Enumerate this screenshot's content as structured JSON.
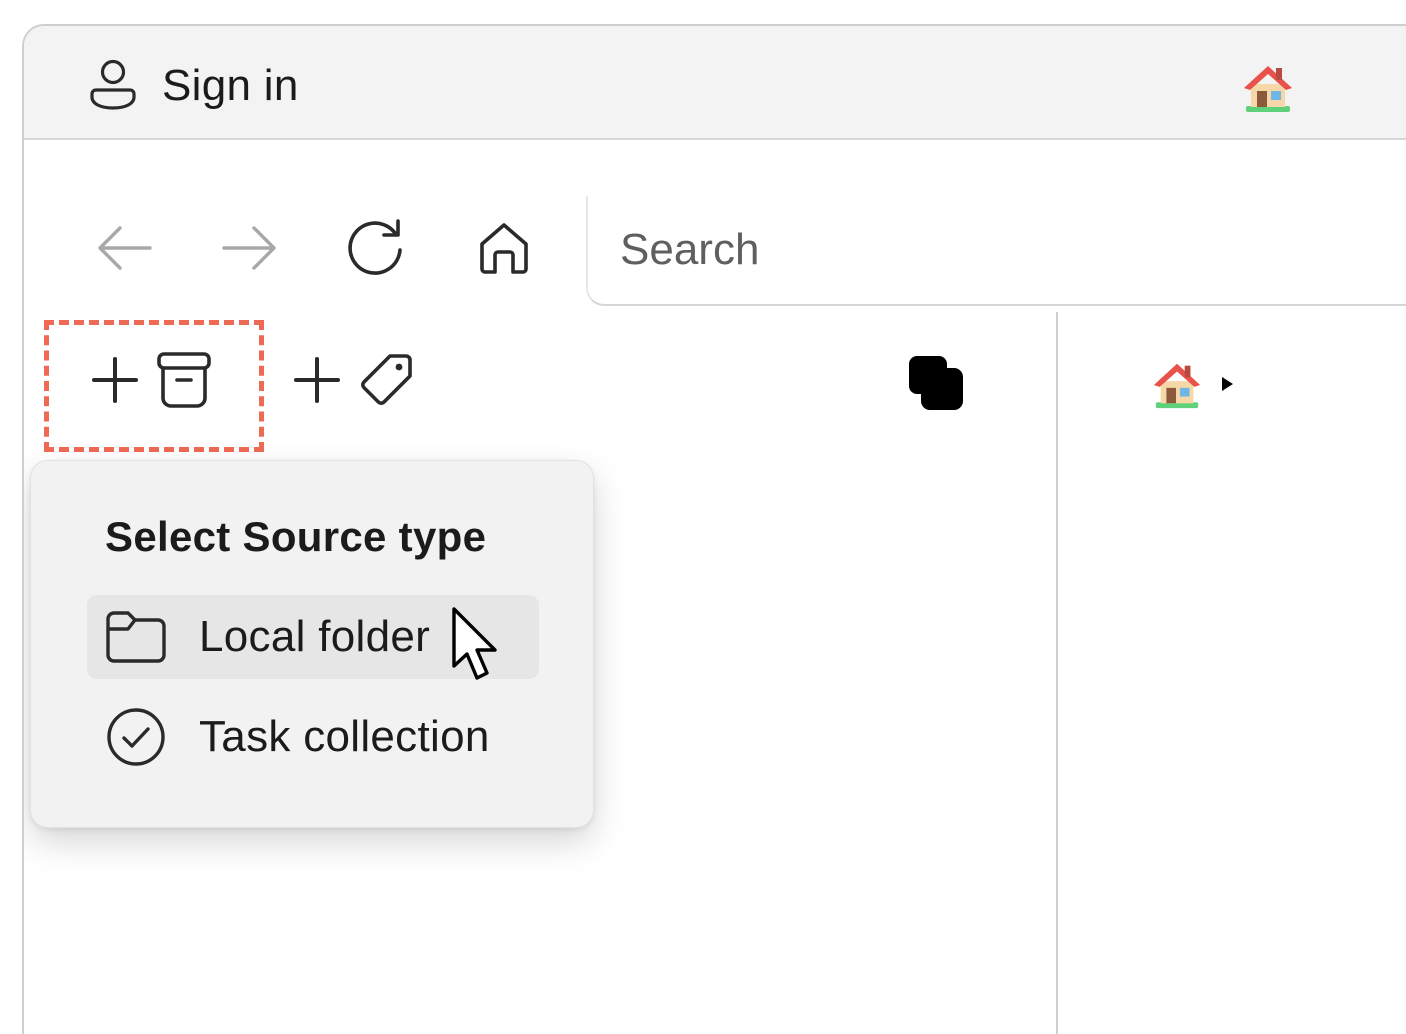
{
  "titlebar": {
    "signin_label": "Sign in",
    "signin_icon": "person-icon",
    "home_icon": "house-emoji-icon"
  },
  "navbar": {
    "back_icon": "arrow-left-icon",
    "forward_icon": "arrow-right-icon",
    "refresh_icon": "refresh-icon",
    "home_icon": "home-icon",
    "search_placeholder": "Search"
  },
  "toolbar": {
    "add_source_icons": [
      "plus-icon",
      "archive-icon"
    ],
    "add_tag_icons": [
      "plus-icon",
      "tag-icon"
    ],
    "copy_icon": "copy-icon"
  },
  "source_popup": {
    "title": "Select Source type",
    "items": [
      {
        "label": "Local folder",
        "icon": "folder-icon",
        "hovered": true
      },
      {
        "label": "Task collection",
        "icon": "check-circle-icon",
        "hovered": false
      }
    ]
  },
  "breadcrumb": {
    "home_icon": "house-emoji-icon",
    "expand_icon": "caret-right-icon"
  },
  "colors": {
    "highlight_dashed_border": "#ef6a55",
    "titlebar_bg": "#f3f3f3",
    "popup_bg": "#f2f2f2",
    "hover_bg": "#e6e6e6"
  }
}
